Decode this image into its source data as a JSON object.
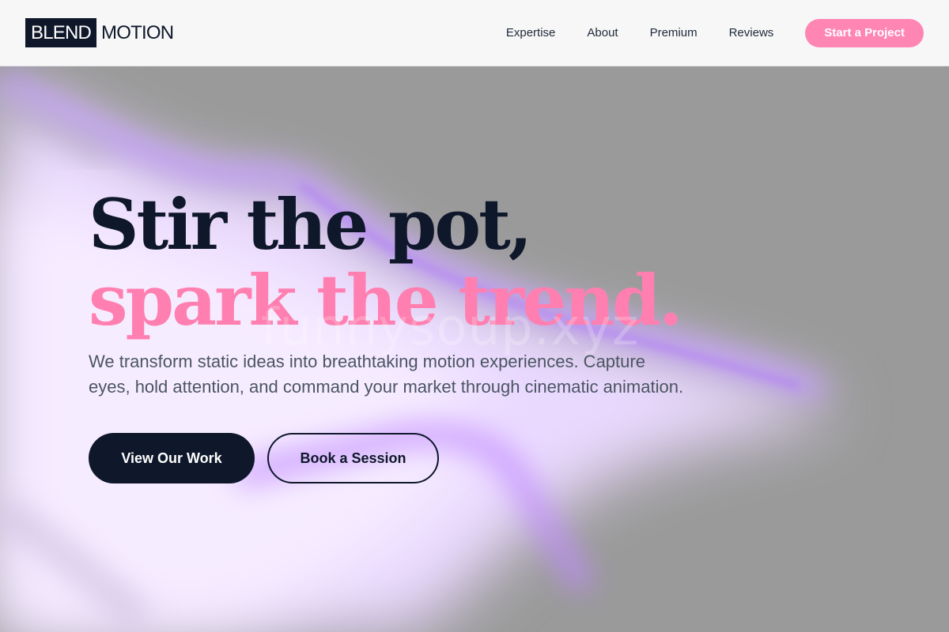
{
  "header": {
    "logo_part1": "BLEND",
    "logo_part2": "MOTION",
    "nav": {
      "expertise": "Expertise",
      "about": "About",
      "premium": "Premium",
      "reviews": "Reviews"
    },
    "cta": "Start a Project"
  },
  "hero": {
    "headline_line1": "Stir the pot,",
    "headline_line2": "spark the trend.",
    "subtitle": "We transform static ideas into breathtaking motion experiences. Capture eyes, hold attention, and command your market through cinematic animation.",
    "primary_button": "View Our Work",
    "secondary_button": "Book a Session",
    "watermark": "funnysoup.xyz"
  },
  "colors": {
    "navy": "#0f172a",
    "pink": "#ff7fb0",
    "pink_button": "#ff85b3",
    "lavender": "#e9d5ff",
    "violet": "#c084fc",
    "gray_bg": "#9a9a9a"
  }
}
